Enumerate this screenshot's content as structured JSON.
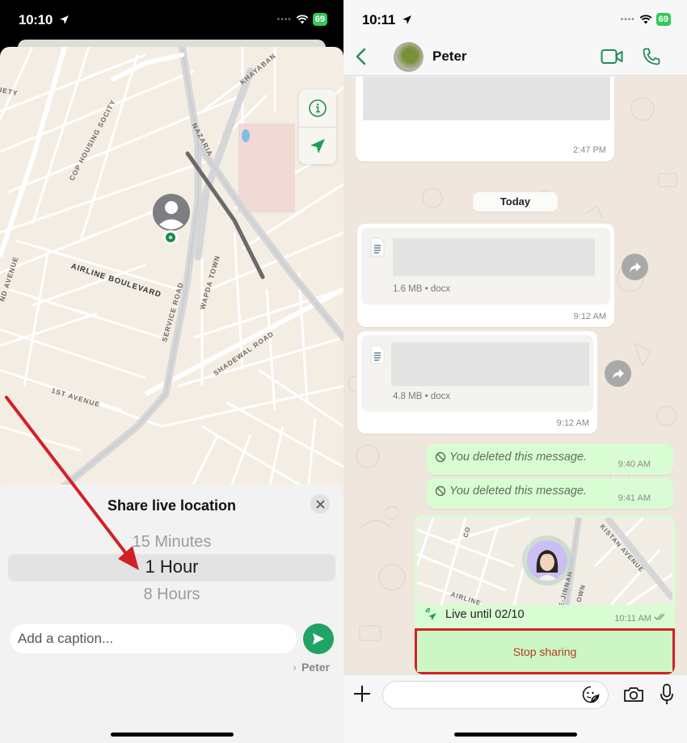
{
  "left_screen": {
    "status_bar": {
      "time": "10:10",
      "battery": "69"
    },
    "map": {
      "labels": [
        "KHAYABAN",
        "COP HOUSING SOCITY",
        "NAZARIA",
        "AIRLINE BOULEVARD",
        "SERVICE ROAD",
        "WAPDA TOWN",
        "SHADEWAL ROAD",
        "1ST AVENUE",
        "IETY",
        "ND AVENUE"
      ],
      "controls": {
        "info_icon": "info-icon",
        "locate_icon": "location-arrow-icon"
      },
      "pin_icon": "user-avatar-pin"
    },
    "sheet": {
      "title": "Share live location",
      "close_icon": "close-icon",
      "duration_options": [
        "15 Minutes",
        "1 Hour",
        "8 Hours"
      ],
      "selected_duration": "1 Hour",
      "caption_placeholder": "Add a caption...",
      "send_icon": "send-icon",
      "recipient": "Peter"
    },
    "annotation": {
      "type": "arrow",
      "color": "#d32027",
      "points_to": "1 Hour"
    }
  },
  "right_screen": {
    "status_bar": {
      "time": "10:11",
      "battery": "69"
    },
    "header": {
      "back_icon": "chevron-left-icon",
      "contact_name": "Peter",
      "video_call_icon": "video-camera-icon",
      "voice_call_icon": "phone-icon"
    },
    "messages": [
      {
        "type": "media",
        "direction": "in",
        "time": "2:47 PM"
      },
      {
        "type": "date",
        "label": "Today"
      },
      {
        "type": "document",
        "direction": "in",
        "size": "1.6 MB",
        "ext": "docx",
        "time": "9:12 AM"
      },
      {
        "type": "document",
        "direction": "in",
        "size": "4.8 MB",
        "ext": "docx",
        "time": "9:12 AM"
      },
      {
        "type": "deleted",
        "direction": "out",
        "text": "You deleted this message.",
        "time": "9:40 AM"
      },
      {
        "type": "deleted",
        "direction": "out",
        "text": "You deleted this message.",
        "time": "9:41 AM"
      },
      {
        "type": "live_location",
        "direction": "out",
        "map_labels": [
          "AIRLINE",
          "E-JINNAH",
          "KISTAN AVENUE",
          "OWN",
          "CO"
        ],
        "status": "Live until 02/10",
        "time": "10:11 AM",
        "read_receipt": "double-check-icon",
        "stop_label": "Stop sharing"
      }
    ],
    "doc_meta_separator": " • ",
    "composer": {
      "plus_icon": "plus-icon",
      "input_value": "",
      "sticker_icon": "sticker-icon",
      "camera_icon": "camera-icon",
      "mic_icon": "microphone-icon"
    },
    "highlight": {
      "color": "#d32027",
      "target": "Stop sharing"
    }
  },
  "colors": {
    "accent_green": "#21a366",
    "outgoing_bubble": "#d9fdd3",
    "chat_bg": "#efe7dd",
    "annotation_red": "#d32027"
  }
}
